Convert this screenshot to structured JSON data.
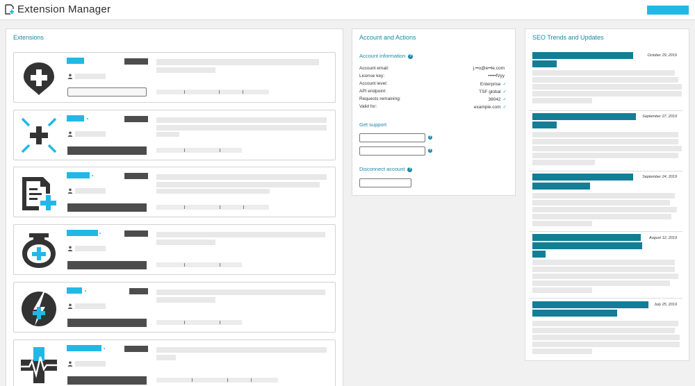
{
  "app": {
    "title": "Extension Manager",
    "accent_color": "#22b8e6",
    "heading_color": "#1a86a8",
    "icons": {
      "logo": "document-plus-icon",
      "user": "user-icon",
      "help": "question-circle-icon",
      "check": "check-icon"
    }
  },
  "extensions_panel": {
    "title": "Extensions",
    "items": [
      {
        "icon": "map-pin-plus-icon"
      },
      {
        "icon": "crosshair-plus-icon"
      },
      {
        "icon": "document-plus-icon"
      },
      {
        "icon": "jar-plus-icon"
      },
      {
        "icon": "lightning-plus-icon"
      },
      {
        "icon": "heartbeat-plus-icon"
      }
    ]
  },
  "account_panel": {
    "title": "Account and Actions",
    "info_heading": "Account information",
    "rows": [
      {
        "label": "Account email:",
        "value": "j.••o@e••le.com",
        "check": ""
      },
      {
        "label": "License key:",
        "value": "•••••fVyy",
        "check": ""
      },
      {
        "label": "Account level:",
        "value": "Enterprise",
        "check": "✓"
      },
      {
        "label": "API endpoint:",
        "value": "TSF global",
        "check": "✓"
      },
      {
        "label": "Requests remaining:",
        "value": "38042",
        "check": "✓"
      },
      {
        "label": "Valid for:",
        "value": "example.com",
        "check": "✓"
      }
    ],
    "support_heading": "Get support",
    "disconnect_heading": "Disconnect account",
    "help_glyph": "?"
  },
  "seo_panel": {
    "title": "SEO Trends and Updates",
    "items": [
      {
        "date": "October 29, 2019"
      },
      {
        "date": "September 27, 2019"
      },
      {
        "date": "September 24, 2019"
      },
      {
        "date": "August 12, 2019"
      },
      {
        "date": "July 25, 2019"
      }
    ]
  }
}
